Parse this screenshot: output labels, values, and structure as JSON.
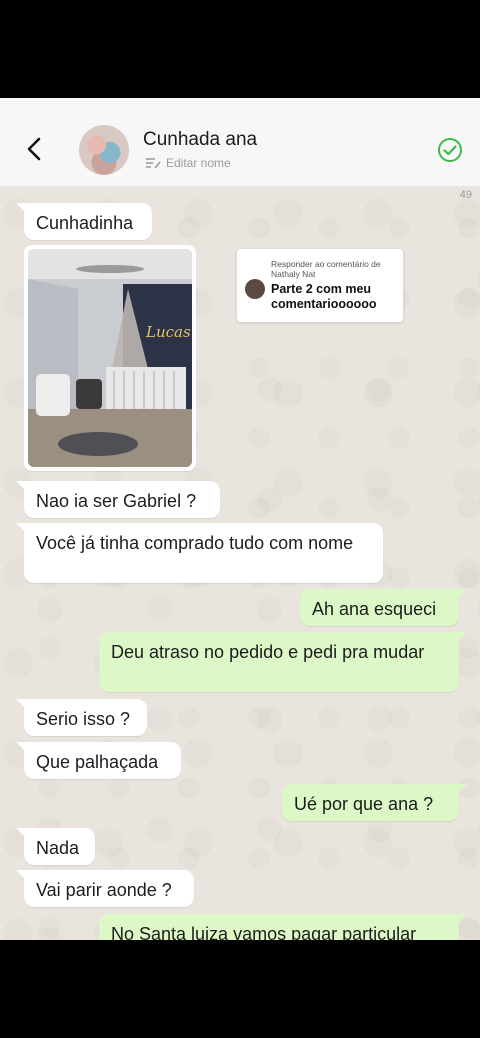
{
  "header": {
    "contact_name": "Cunhada ana",
    "edit_label": "Editar nome"
  },
  "counter": "49",
  "reply_overlay": {
    "label": "Responder ao comentário de Nathaly Nat",
    "text": "Parte 2 com meu comentarioooooo"
  },
  "photo": {
    "sign_text": "Lucas"
  },
  "messages": [
    {
      "direction": "incoming",
      "text": "Cunhadinha"
    },
    {
      "direction": "incoming",
      "text": "Nao ia ser Gabriel ?"
    },
    {
      "direction": "incoming",
      "text": "Você já tinha comprado tudo com nome"
    },
    {
      "direction": "outgoing",
      "text": "Ah ana esqueci"
    },
    {
      "direction": "outgoing",
      "text": "Deu atraso no pedido e pedi pra mudar"
    },
    {
      "direction": "incoming",
      "text": "Serio isso ?"
    },
    {
      "direction": "incoming",
      "text": "Que palhaçada"
    },
    {
      "direction": "outgoing",
      "text": "Ué por que ana ?"
    },
    {
      "direction": "incoming",
      "text": "Nada"
    },
    {
      "direction": "incoming",
      "text": "Vai parir aonde ?"
    },
    {
      "direction": "outgoing",
      "text": "No Santa luiza vamos pagar particular"
    }
  ],
  "colors": {
    "incoming_bubble": "#ffffff",
    "outgoing_bubble": "#dcf8c6",
    "verify_icon": "#3dbb4a"
  }
}
